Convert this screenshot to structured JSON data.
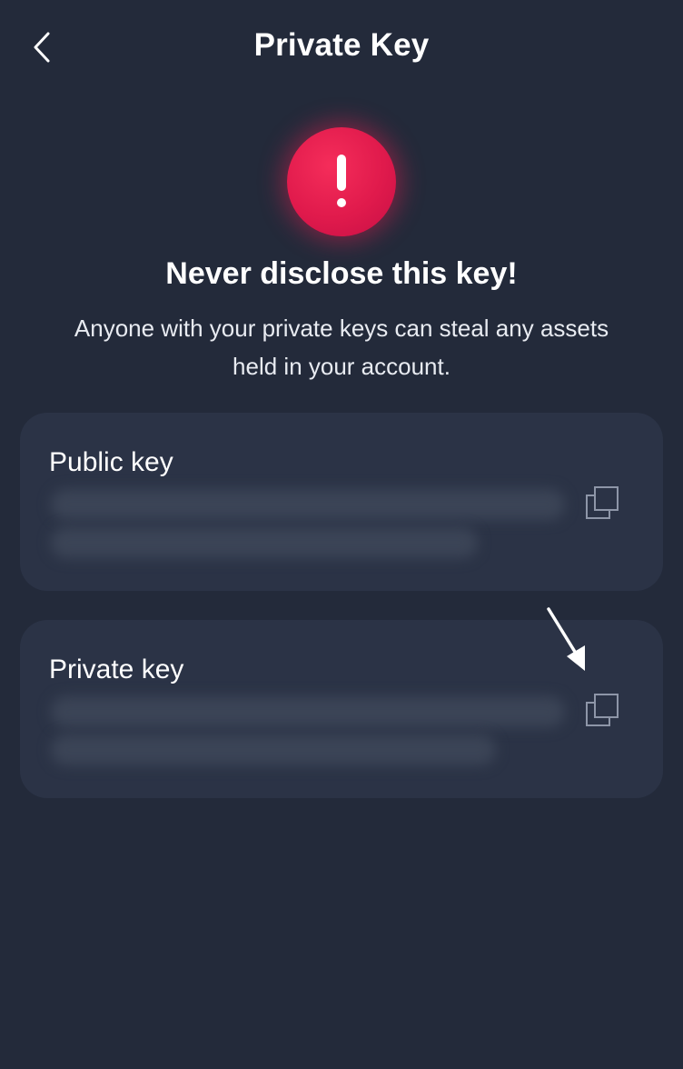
{
  "header": {
    "title": "Private Key",
    "back_icon": "chevron-left-icon"
  },
  "warning": {
    "icon": "exclamation-icon",
    "accent_color": "#e6194f",
    "title": "Never disclose this key!",
    "text": "Anyone with your private keys can steal any assets held in your account."
  },
  "keys": [
    {
      "label": "Public key",
      "copy_icon": "copy-icon"
    },
    {
      "label": "Private key",
      "copy_icon": "copy-icon"
    }
  ],
  "colors": {
    "background": "#232a3a",
    "card": "#2b3346"
  }
}
